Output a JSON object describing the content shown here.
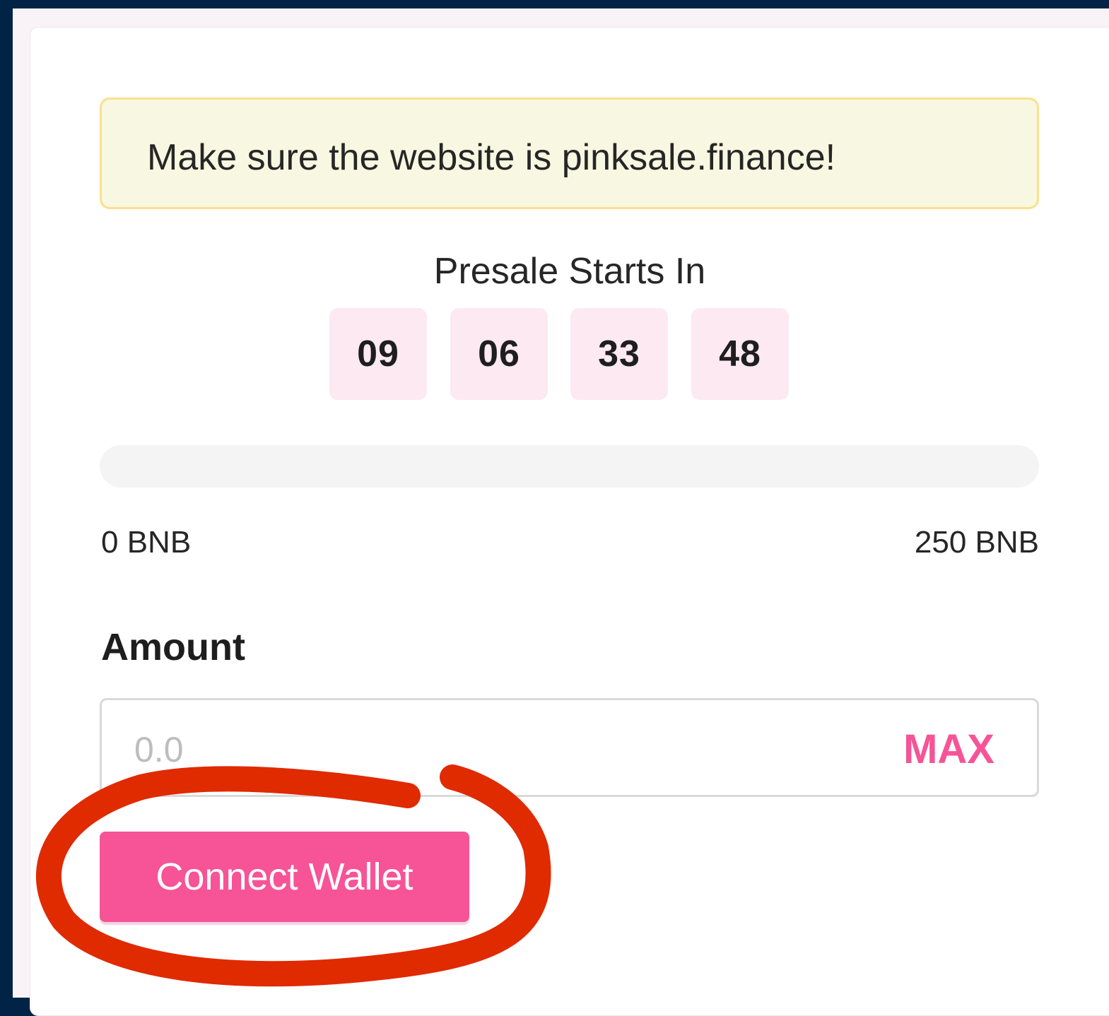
{
  "notice": {
    "text": "Make sure the website is pinksale.finance!"
  },
  "presale": {
    "title": "Presale Starts In",
    "countdown": [
      "09",
      "06",
      "33",
      "48"
    ]
  },
  "progress": {
    "fraction": 0,
    "min_label": "0 BNB",
    "max_label": "250 BNB"
  },
  "amount": {
    "label": "Amount",
    "value": "",
    "placeholder": "0.0",
    "max_label": "MAX"
  },
  "actions": {
    "connect_label": "Connect Wallet"
  },
  "colors": {
    "accent": "#f65497",
    "page_background": "#012346",
    "notice_background": "#f8f7e1",
    "notice_border": "#fbe08c",
    "timer_background": "#fce9f1",
    "annotation_circle": "#e02a00"
  }
}
